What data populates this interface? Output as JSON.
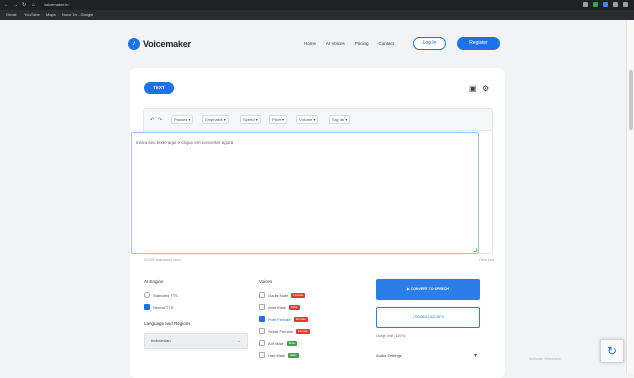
{
  "browser": {
    "url": "voicemaker.in",
    "bookmarks": [
      "Gmail",
      "YouTube",
      "Maps",
      "Novo 1h - Google"
    ]
  },
  "header": {
    "logo_text": "Voicemaker",
    "nav": [
      "Home",
      "AI Voices",
      "Pricing",
      "Contact"
    ],
    "login_label": "Log In",
    "register_label": "Register"
  },
  "editor": {
    "tab_label": "TEXT",
    "toolbar": [
      "Pauses ▾",
      "Emphasis ▾",
      "Speed ▾",
      "Pitch ▾",
      "Volume ▾",
      "Say as ▾"
    ],
    "content": "Insira seu texto aqui e clique em converter agora",
    "footer_left": "0/2000 characters used",
    "footer_right": "Clear text"
  },
  "ai_engine": {
    "title": "AI Engine",
    "options": [
      "Standard TTS",
      "Neural TTS"
    ],
    "selected": "Neural TTS"
  },
  "language": {
    "title": "Language and Regions",
    "selected": "Indonesian"
  },
  "voices": {
    "title": "Voices",
    "items": [
      {
        "name": "Gadis Male",
        "badge": "Female",
        "checked": false
      },
      {
        "name": "Arief Male",
        "badge": "Male",
        "checked": false
      },
      {
        "name": "Putri Female",
        "badge": "Female",
        "checked": true
      },
      {
        "name": "Sekar Female",
        "badge": "Female",
        "checked": false
      },
      {
        "name": "Arif Male",
        "badge": "Male",
        "checked": false
      },
      {
        "name": "Hari Male",
        "badge": "Male",
        "checked": false
      }
    ]
  },
  "actions": {
    "convert_label": "CONVERT TO SPEECH",
    "download_label": "DOWNLOAD MP3",
    "usage": "Usage limit (100%)",
    "audio_settings": "Audio Settings"
  },
  "overlay": {
    "activate_windows": "Activate Windows"
  },
  "colors": {
    "accent": "#1a73e8",
    "badge_red": "#e53935",
    "badge_green": "#43a047"
  }
}
